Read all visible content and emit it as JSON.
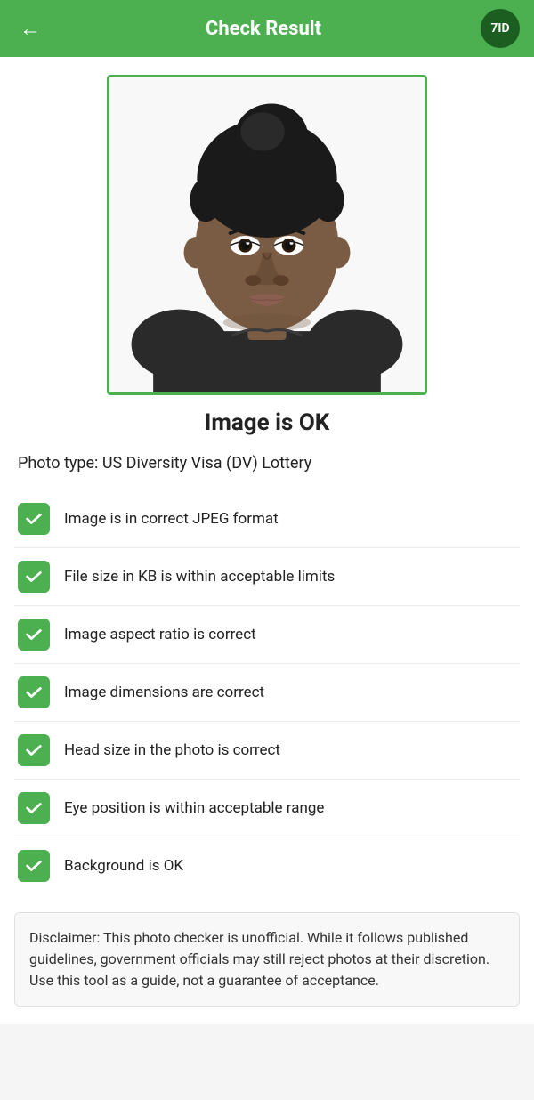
{
  "header": {
    "title": "Check Result",
    "back_icon": "←",
    "logo_text": "7ID"
  },
  "status": {
    "title": "Image is OK"
  },
  "photo_type": {
    "label": "Photo type: US Diversity Visa (DV) Lottery"
  },
  "checks": [
    {
      "id": "jpeg-format",
      "text": "Image is in correct JPEG format",
      "passed": true
    },
    {
      "id": "file-size",
      "text": "File size in KB is within acceptable limits",
      "passed": true
    },
    {
      "id": "aspect-ratio",
      "text": "Image aspect ratio is correct",
      "passed": true
    },
    {
      "id": "dimensions",
      "text": "Image dimensions are correct",
      "passed": true
    },
    {
      "id": "head-size",
      "text": "Head size in the photo is correct",
      "passed": true
    },
    {
      "id": "eye-position",
      "text": "Eye position is within acceptable range",
      "passed": true
    },
    {
      "id": "background",
      "text": "Background is OK",
      "passed": true
    }
  ],
  "disclaimer": {
    "text": "Disclaimer: This photo checker is unofficial. While it follows published guidelines, government officials may still reject photos at their discretion. Use this tool as a guide, not a guarantee of acceptance."
  }
}
